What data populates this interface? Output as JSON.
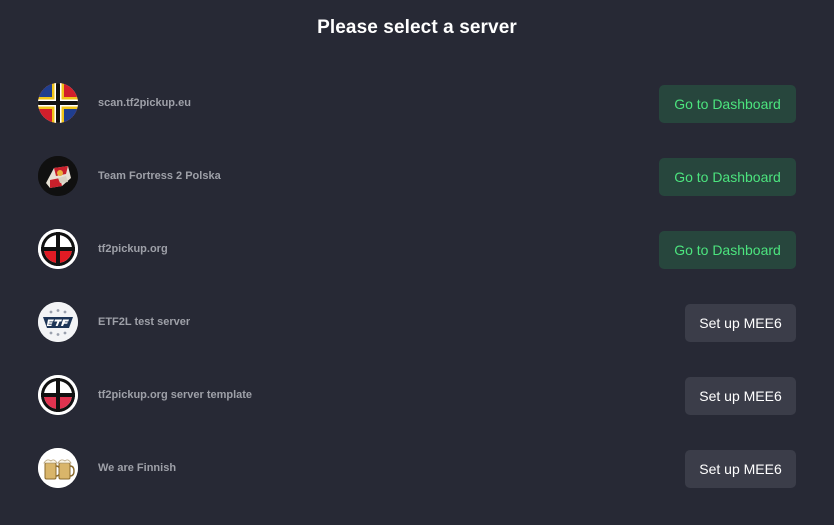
{
  "page": {
    "title": "Please select a server"
  },
  "servers": [
    {
      "name": "scan.tf2pickup.eu",
      "icon": "scandinavian-cross-flag-icon",
      "action_label": "Go to Dashboard",
      "action": "dashboard"
    },
    {
      "name": "Team Fortress 2 Polska",
      "icon": "tf2-polska-emblem-icon",
      "action_label": "Go to Dashboard",
      "action": "dashboard"
    },
    {
      "name": "tf2pickup.org",
      "icon": "tf2pickup-crosshair-icon",
      "action_label": "Go to Dashboard",
      "action": "dashboard"
    },
    {
      "name": "ETF2L test server",
      "icon": "etf2l-logo-icon",
      "action_label": "Set up MEE6",
      "action": "setup"
    },
    {
      "name": "tf2pickup.org server template",
      "icon": "tf2pickup-crosshair-pink-icon",
      "action_label": "Set up MEE6",
      "action": "setup"
    },
    {
      "name": "We are Finnish",
      "icon": "beer-mugs-icon",
      "action_label": "Set up MEE6",
      "action": "setup"
    }
  ],
  "colors": {
    "background": "#272935",
    "dashboard_button_bg": "#27463d",
    "dashboard_button_text": "#4ce47e",
    "setup_button_bg": "#3b3d49",
    "setup_button_text": "#ffffff",
    "server_name_text": "#9ea0a8"
  }
}
